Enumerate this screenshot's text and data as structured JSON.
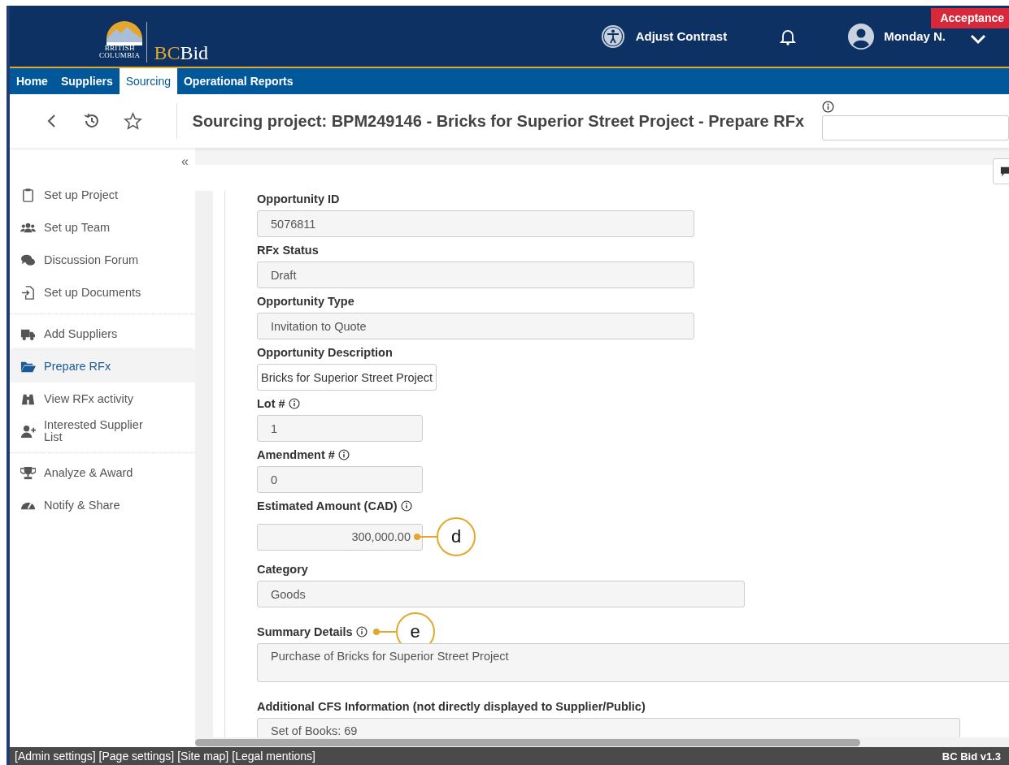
{
  "header": {
    "logo_line_1": "BRITISH",
    "logo_line_2": "COLUMBIA",
    "brand_1": "BC",
    "brand_2": "Bid",
    "contrast": "Adjust Contrast",
    "user": "Monday N.",
    "environment": "Acceptance"
  },
  "nav": [
    {
      "label": "Home",
      "selected": false
    },
    {
      "label": "Suppliers",
      "selected": false
    },
    {
      "label": "Sourcing",
      "selected": true
    },
    {
      "label": "Operational Reports",
      "selected": false
    }
  ],
  "title": "Sourcing project: BPM249146 - Bricks for Superior Street Project - Prepare RFx",
  "sidebar": {
    "collapse": "«",
    "groups": [
      {
        "items": [
          {
            "label": "Set up Project",
            "selected": false
          },
          {
            "label": "Set up Team",
            "selected": false
          },
          {
            "label": "Discussion Forum",
            "selected": false
          },
          {
            "label": "Set up Documents",
            "selected": false
          }
        ]
      },
      {
        "items": [
          {
            "label": "Add Suppliers",
            "selected": false
          },
          {
            "label": "Prepare RFx",
            "selected": true
          },
          {
            "label": "View RFx activity",
            "selected": false
          },
          {
            "label": "Interested Supplier List",
            "selected": false
          }
        ]
      },
      {
        "items": [
          {
            "label": "Analyze & Award",
            "selected": false
          },
          {
            "label": "Notify & Share",
            "selected": false
          }
        ]
      }
    ]
  },
  "form": {
    "fields": [
      {
        "label": "Opportunity ID",
        "value": "5076811",
        "kind": "text",
        "readonly": true,
        "info": false
      },
      {
        "label": "RFx Status",
        "value": "Draft",
        "kind": "text",
        "readonly": true,
        "info": false
      },
      {
        "label": "Opportunity Type",
        "value": "Invitation to Quote",
        "kind": "text",
        "readonly": true,
        "info": false
      },
      {
        "label": "Opportunity Description",
        "value": "Bricks for Superior Street Project",
        "kind": "text",
        "readonly": false,
        "info": false
      },
      {
        "label": "Lot #",
        "value": "1",
        "kind": "text",
        "readonly": true,
        "info": true
      },
      {
        "label": "Amendment #",
        "value": "0",
        "kind": "text",
        "readonly": true,
        "info": true
      },
      {
        "label": "Estimated Amount (CAD)",
        "value": "300,000.00",
        "kind": "number",
        "readonly": true,
        "info": true,
        "callout": "d"
      },
      {
        "label": "Category",
        "value": "Goods",
        "kind": "text",
        "readonly": true,
        "info": false
      },
      {
        "label": "Summary Details",
        "value": "Purchase of Bricks for Superior Street Project",
        "kind": "textarea",
        "readonly": true,
        "info": true,
        "label_callout": "e"
      },
      {
        "label": "Additional CFS Information (not directly displayed to Supplier/Public)",
        "value": "Set of Books: 69",
        "kind": "textarea",
        "readonly": true,
        "info": false
      }
    ]
  },
  "footer": {
    "links": [
      "[Admin settings]",
      "[Page settings]",
      "[Site map]",
      "[Legal mentions]"
    ],
    "version": "BC Bid v1.3"
  }
}
